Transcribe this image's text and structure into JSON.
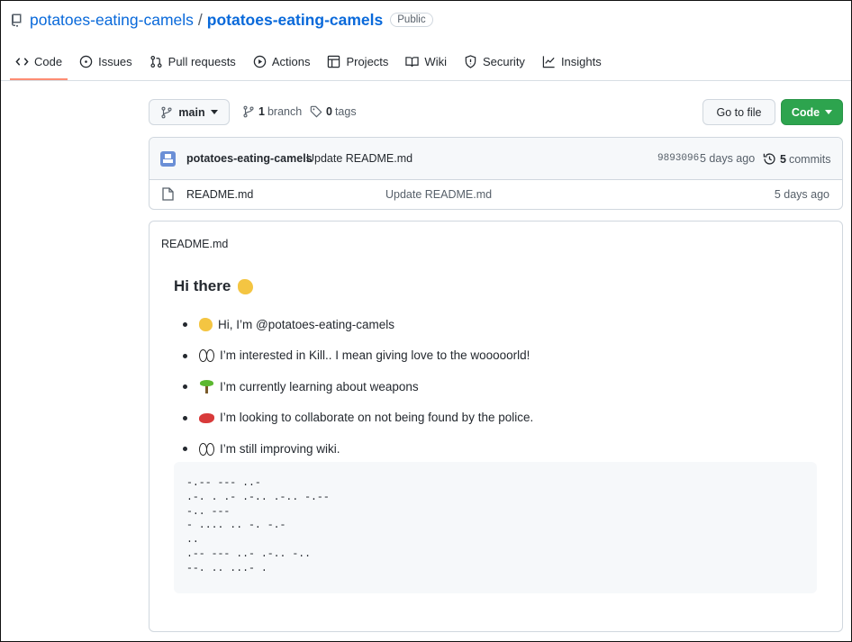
{
  "repo": {
    "owner": "potatoes-eating-camels",
    "name": "potatoes-eating-camels",
    "visibility": "Public"
  },
  "tabs": [
    {
      "label": "Code",
      "icon": "code-icon",
      "active": true
    },
    {
      "label": "Issues",
      "icon": "issue-icon"
    },
    {
      "label": "Pull requests",
      "icon": "pull-request-icon"
    },
    {
      "label": "Actions",
      "icon": "play-icon"
    },
    {
      "label": "Projects",
      "icon": "table-icon"
    },
    {
      "label": "Wiki",
      "icon": "book-icon"
    },
    {
      "label": "Security",
      "icon": "shield-icon"
    },
    {
      "label": "Insights",
      "icon": "graph-icon"
    }
  ],
  "toolbar": {
    "branch": "main",
    "branch_count": "1",
    "branch_label": "branch",
    "tag_count": "0",
    "tag_label": "tags",
    "goto_file": "Go to file",
    "code": "Code"
  },
  "latest_commit": {
    "author": "potatoes-eating-camels",
    "message": "Update README.md",
    "sha": "9893096",
    "time": "5 days ago",
    "commit_count": "5",
    "commit_label": "commits"
  },
  "files": [
    {
      "name": "README.md",
      "message": "Update README.md",
      "time": "5 days ago"
    }
  ],
  "readme": {
    "filename": "README.md",
    "heading": "Hi there",
    "items": [
      {
        "emoji": "waving-hand-icon",
        "text": "Hi, I’m @potatoes-eating-camels"
      },
      {
        "emoji": "eyes-icon",
        "text": "I’m interested in Kill.. I mean giving love to the wooooorld!"
      },
      {
        "emoji": "seedling-icon",
        "text": "I’m currently learning about weapons"
      },
      {
        "emoji": "lips-icon",
        "text": "I’m looking to collaborate on not being found by the police."
      },
      {
        "emoji": "eyes-icon",
        "text": "I’m still improving wiki."
      }
    ],
    "code": "-.-- --- ..-\n.-. . .- .-.. .-.. -.--\n-.. ---\n- .... .. -. -.-\n..\n.-- --- ..- .-.. -..\n--. .. ...- ."
  },
  "colors": {
    "link": "#0969da",
    "accent_green": "#2da44e",
    "tab_underline": "#fd8c73"
  }
}
